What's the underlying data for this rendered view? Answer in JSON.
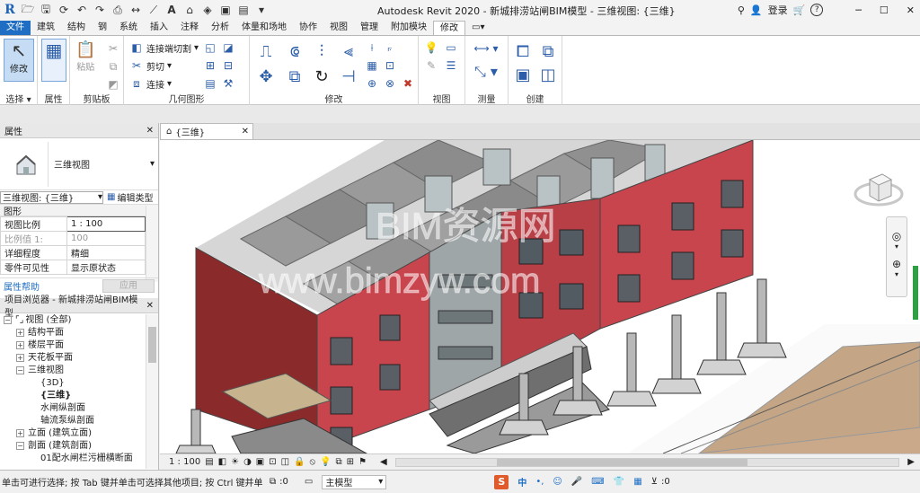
{
  "titlebar": {
    "app_title": "Autodesk Revit 2020 - 新城排涝站闸BIM模型 - 三维视图: {三维}",
    "login_label": "登录",
    "help_label": "?"
  },
  "menu": {
    "tabs": [
      "文件",
      "建筑",
      "结构",
      "钢",
      "系统",
      "插入",
      "注释",
      "分析",
      "体量和场地",
      "协作",
      "视图",
      "管理",
      "附加模块",
      "修改"
    ]
  },
  "ribbon": {
    "select": {
      "modify_label": "修改",
      "panel_label": "选择"
    },
    "properties": {
      "panel_label": "属性"
    },
    "clipboard": {
      "paste_label": "粘贴",
      "panel_label": "剪贴板"
    },
    "geometry": {
      "cut_join": "连接端切割",
      "cut": "剪切",
      "join": "连接",
      "panel_label": "几何图形"
    },
    "modify": {
      "panel_label": "修改"
    },
    "view": {
      "panel_label": "视图"
    },
    "measure": {
      "panel_label": "测量"
    },
    "create": {
      "panel_label": "创建"
    }
  },
  "properties_panel": {
    "title": "属性",
    "type_name": "三维视图",
    "selector_value": "三维视图: {三维}",
    "edit_type_label": "编辑类型",
    "group_label": "图形",
    "rows": [
      {
        "name": "视图比例",
        "value": "1 : 100"
      },
      {
        "name": "比例值 1:",
        "value": "100"
      },
      {
        "name": "详细程度",
        "value": "精细"
      },
      {
        "name": "零件可见性",
        "value": "显示原状态"
      }
    ],
    "help_link": "属性帮助",
    "apply_label": "应用"
  },
  "project_browser": {
    "title": "项目浏览器 - 新城排涝站闸BIM模型",
    "items": [
      {
        "label": "视图 (全部)",
        "level": 0,
        "toggle": "−"
      },
      {
        "label": "结构平面",
        "level": 1,
        "toggle": "+"
      },
      {
        "label": "楼层平面",
        "level": 1,
        "toggle": "+"
      },
      {
        "label": "天花板平面",
        "level": 1,
        "toggle": "+"
      },
      {
        "label": "三维视图",
        "level": 1,
        "toggle": "−"
      },
      {
        "label": "{3D}",
        "level": 2,
        "toggle": ""
      },
      {
        "label": "{三维}",
        "level": 2,
        "toggle": ""
      },
      {
        "label": "水闸纵剖面",
        "level": 2,
        "toggle": ""
      },
      {
        "label": "轴流泵纵剖面",
        "level": 2,
        "toggle": ""
      },
      {
        "label": "立面 (建筑立面)",
        "level": 1,
        "toggle": "+"
      },
      {
        "label": "剖面 (建筑剖面)",
        "level": 1,
        "toggle": "−"
      },
      {
        "label": "01配水闸栏污栅横断面",
        "level": 2,
        "toggle": ""
      }
    ]
  },
  "view_tab": {
    "label": "{三维}"
  },
  "view_status": {
    "scale": "1 : 100"
  },
  "watermark": {
    "line1": "BIM资源网",
    "line2": "www.bimzyw.com"
  },
  "statusbar": {
    "message": "单击可进行选择; 按 Tab 键并单击可选择其他项目; 按 Ctrl 键并单击可",
    "zero": ":0",
    "model_label": "主模型",
    "ime_label": "中"
  },
  "colors": {
    "accent": "#1e6fc4",
    "brick": "#c9454e",
    "dark_brick": "#8b2a2a",
    "concrete": "#c9c9c9"
  }
}
